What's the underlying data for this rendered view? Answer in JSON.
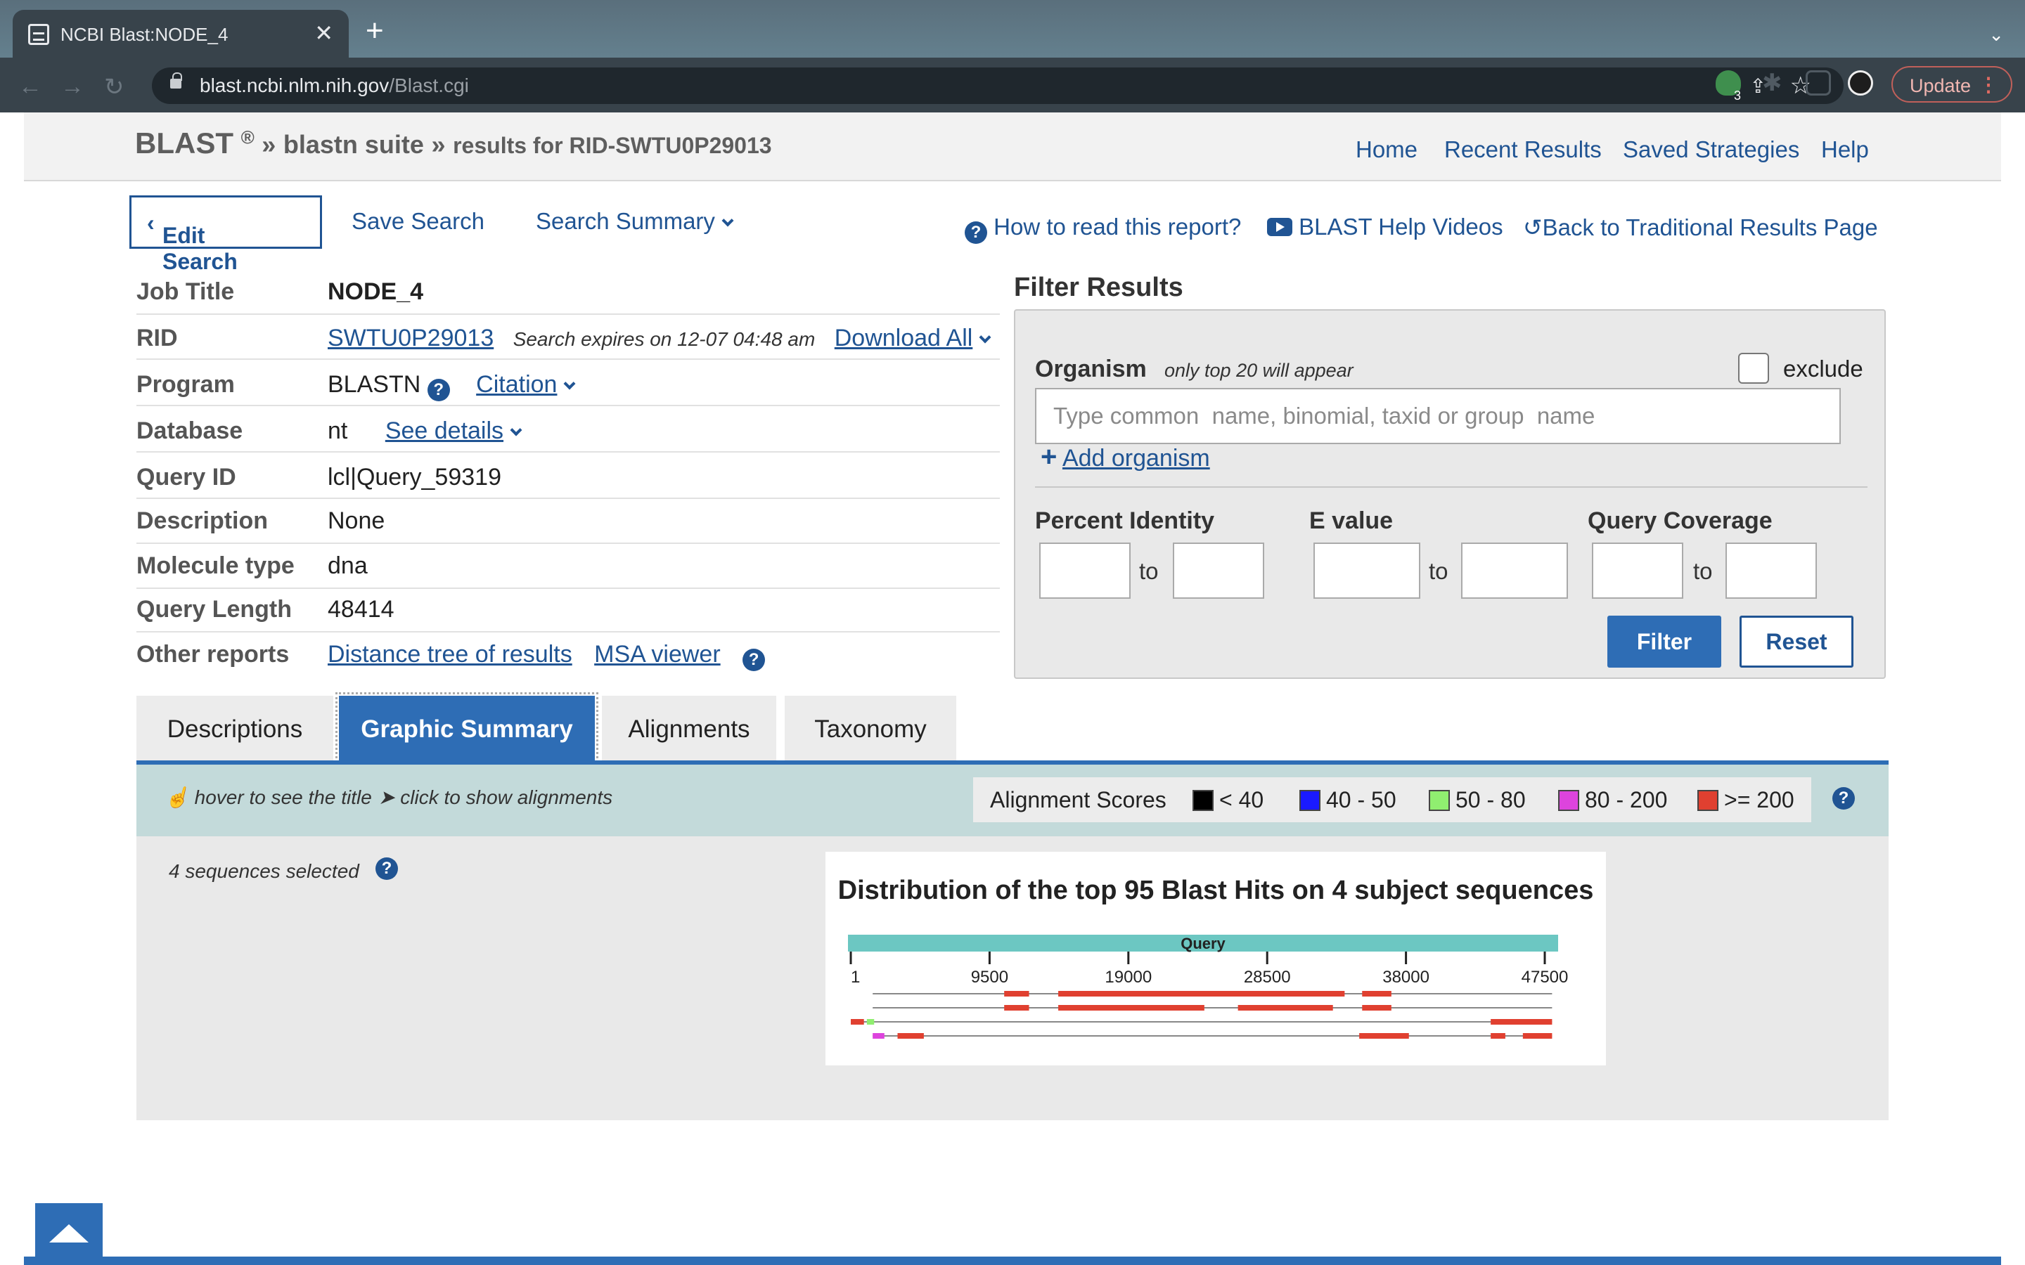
{
  "browser": {
    "tab_title": "NCBI Blast:NODE_4",
    "url_host": "blast.ncbi.nlm.nih.gov",
    "url_path": "/Blast.cgi",
    "update_label": "Update",
    "extension_badge": "3"
  },
  "header": {
    "blast": "BLAST",
    "reg": "®",
    "sep1": "»",
    "suite": "blastn suite",
    "sep2": "»",
    "results": "results for RID-SWTU0P29013",
    "nav": [
      "Home",
      "Recent Results",
      "Saved Strategies",
      "Help"
    ]
  },
  "actions": {
    "edit_search": "Edit Search",
    "save_search": "Save Search",
    "search_summary": "Search Summary",
    "how_to_read": "How to read this report?",
    "help_videos": "BLAST Help Videos",
    "back_traditional": "Back to Traditional Results Page"
  },
  "job": {
    "job_title_label": "Job Title",
    "job_title": "NODE_4",
    "rid_label": "RID",
    "rid": "SWTU0P29013",
    "expires": "Search expires on 12-07 04:48 am",
    "download_all": "Download All",
    "program_label": "Program",
    "program": "BLASTN",
    "citation": "Citation",
    "database_label": "Database",
    "database": "nt",
    "see_details": "See details",
    "query_id_label": "Query ID",
    "query_id": "lcl|Query_59319",
    "description_label": "Description",
    "description": "None",
    "molecule_type_label": "Molecule type",
    "molecule_type": "dna",
    "query_length_label": "Query Length",
    "query_length": "48414",
    "other_reports_label": "Other reports",
    "distance_tree": "Distance tree of results",
    "msa_viewer": "MSA viewer"
  },
  "filter": {
    "title": "Filter Results",
    "organism_label": "Organism",
    "organism_note": "only top 20 will appear",
    "exclude_label": "exclude",
    "organism_placeholder": "Type common  name, binomial, taxid or group  name",
    "add_organism": "Add organism",
    "percent_identity": "Percent Identity",
    "e_value": "E value",
    "query_coverage": "Query Coverage",
    "to": "to",
    "filter_button": "Filter",
    "reset_button": "Reset"
  },
  "tabs": [
    "Descriptions",
    "Graphic Summary",
    "Alignments",
    "Taxonomy"
  ],
  "active_tab": "Graphic Summary",
  "legend": {
    "hover_hint": "hover to see the title",
    "click_hint": "click to show alignments",
    "scores_label": "Alignment Scores",
    "scores": [
      {
        "label": "< 40",
        "color": "#000000"
      },
      {
        "label": "40 - 50",
        "color": "#1a1aff"
      },
      {
        "label": "50 - 80",
        "color": "#90ee70"
      },
      {
        "label": "80 - 200",
        "color": "#dd44dd"
      },
      {
        "label": ">= 200",
        "color": "#e04030"
      }
    ]
  },
  "graphic": {
    "sequences_selected": "4 sequences selected",
    "title": "Distribution of the top 95 Blast Hits on 4 subject sequences",
    "query_label": "Query",
    "ticks": [
      "1",
      "9500",
      "19000",
      "28500",
      "38000",
      "47500"
    ]
  },
  "chart_data": {
    "type": "bar",
    "title": "Distribution of the top 95 Blast Hits on 4 subject sequences",
    "query_length": 48414,
    "tick_values": [
      1,
      9500,
      19000,
      28500,
      38000,
      47500
    ],
    "subjects": [
      {
        "line": [
          1500,
          48000
        ],
        "hits": [
          {
            "from": 10500,
            "to": 12200,
            "score": ">= 200"
          },
          {
            "from": 14200,
            "to": 33800,
            "score": ">= 200"
          },
          {
            "from": 35000,
            "to": 37000,
            "score": ">= 200"
          }
        ]
      },
      {
        "line": [
          1500,
          48000
        ],
        "hits": [
          {
            "from": 10500,
            "to": 12200,
            "score": ">= 200"
          },
          {
            "from": 14200,
            "to": 24200,
            "score": ">= 200"
          },
          {
            "from": 26500,
            "to": 33000,
            "score": ">= 200"
          },
          {
            "from": 35000,
            "to": 37000,
            "score": ">= 200"
          }
        ]
      },
      {
        "line": [
          0,
          48000
        ],
        "hits": [
          {
            "from": 0,
            "to": 900,
            "score": ">= 200"
          },
          {
            "from": 1100,
            "to": 1600,
            "score": "50 - 80"
          },
          {
            "from": 43800,
            "to": 48000,
            "score": ">= 200"
          }
        ]
      },
      {
        "line": [
          1500,
          48000
        ],
        "hits": [
          {
            "from": 1500,
            "to": 2300,
            "score": "80 - 200"
          },
          {
            "from": 3200,
            "to": 5000,
            "score": ">= 200"
          },
          {
            "from": 34800,
            "to": 38200,
            "score": ">= 200"
          },
          {
            "from": 43800,
            "to": 44800,
            "score": ">= 200"
          },
          {
            "from": 46000,
            "to": 48000,
            "score": ">= 200"
          }
        ]
      }
    ]
  }
}
